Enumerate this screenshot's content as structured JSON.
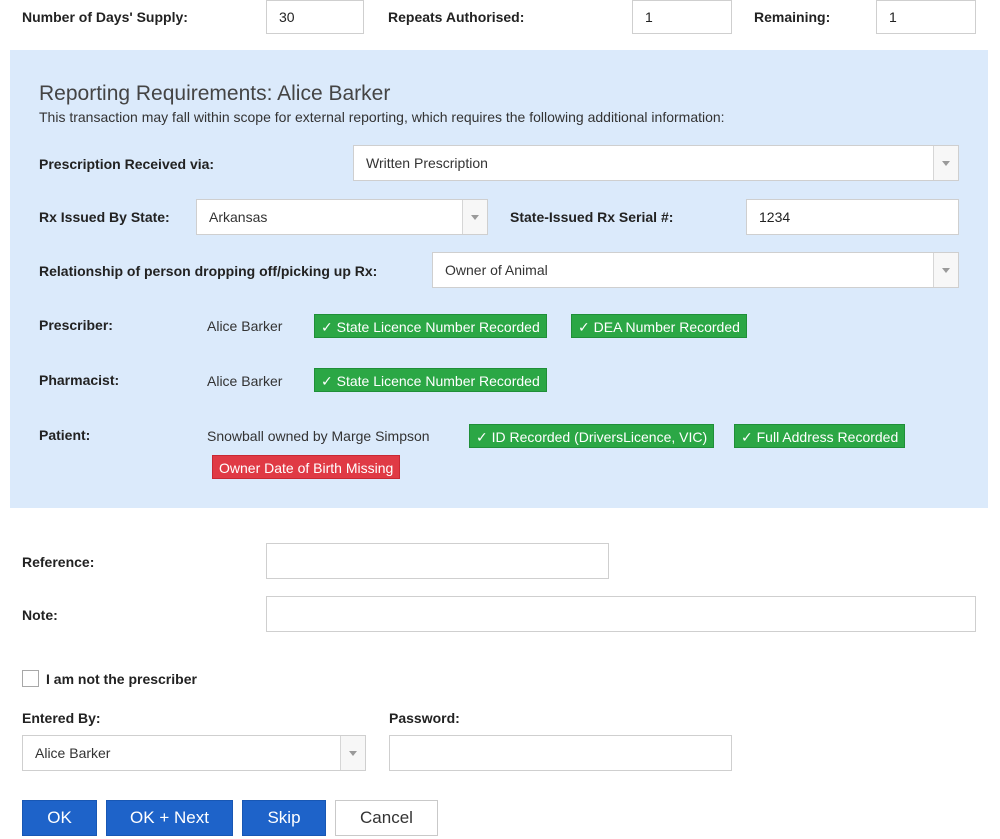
{
  "supply": {
    "days_label": "Number of Days' Supply:",
    "days_value": "30",
    "repeats_label": "Repeats Authorised:",
    "repeats_value": "1",
    "remaining_label": "Remaining:",
    "remaining_value": "1"
  },
  "reporting": {
    "title": "Reporting Requirements: Alice Barker",
    "description": "This transaction may fall within scope for external reporting, which requires the following additional information:",
    "received_via_label": "Prescription Received via:",
    "received_via_value": "Written Prescription",
    "state_label": "Rx Issued By State:",
    "state_value": "Arkansas",
    "serial_label": "State-Issued Rx Serial #:",
    "serial_value": "1234",
    "relationship_label": "Relationship of person dropping off/picking up Rx:",
    "relationship_value": "Owner of Animal",
    "prescriber_label": "Prescriber:",
    "prescriber_name": "Alice Barker",
    "prescriber_badges": [
      "✓ State Licence Number Recorded",
      "✓ DEA Number Recorded"
    ],
    "pharmacist_label": "Pharmacist:",
    "pharmacist_name": "Alice Barker",
    "pharmacist_badges": [
      "✓ State Licence Number Recorded"
    ],
    "patient_label": "Patient:",
    "patient_name": "Snowball owned by Marge Simpson",
    "patient_badges": [
      "✓ ID Recorded (DriversLicence, VIC)",
      "✓ Full Address Recorded"
    ],
    "patient_missing": "Owner Date of Birth Missing"
  },
  "form": {
    "reference_label": "Reference:",
    "reference_value": "",
    "note_label": "Note:",
    "note_value": "",
    "not_prescriber_label": "I am not the prescriber",
    "entered_by_label": "Entered By:",
    "entered_by_value": "Alice Barker",
    "password_label": "Password:",
    "password_value": ""
  },
  "buttons": {
    "ok": "OK",
    "ok_next": "OK + Next",
    "skip": "Skip",
    "cancel": "Cancel"
  },
  "colors": {
    "panel_bg": "#dbeafb",
    "success": "#2ba745",
    "danger": "#e03a45",
    "primary": "#1e63c9"
  }
}
